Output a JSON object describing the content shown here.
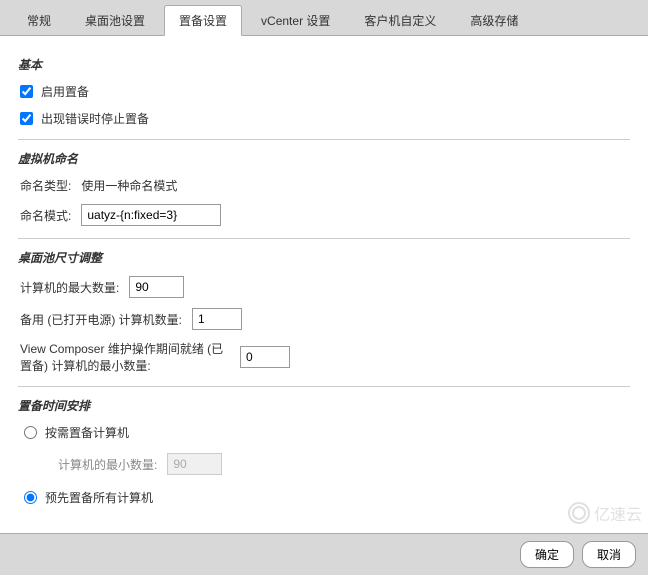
{
  "tabs": {
    "general": "常规",
    "pool_settings": "桌面池设置",
    "provisioning_settings": "置备设置",
    "vcenter_settings": "vCenter 设置",
    "guest_customization": "客户机自定义",
    "advanced_storage": "高级存储"
  },
  "sections": {
    "basic": {
      "title": "基本",
      "enable_provisioning": "启用置备",
      "stop_on_error": "出现错误时停止置备"
    },
    "vm_naming": {
      "title": "虚拟机命名",
      "naming_type_label": "命名类型:",
      "naming_type_value": "使用一种命名模式",
      "naming_pattern_label": "命名模式:",
      "naming_pattern_value": "uatyz-{n:fixed=3}"
    },
    "pool_sizing": {
      "title": "桌面池尺寸调整",
      "max_machines_label": "计算机的最大数量:",
      "max_machines_value": "90",
      "spare_machines_label": "备用 (已打开电源) 计算机数量:",
      "spare_machines_value": "1",
      "min_ready_label": "View Composer 维护操作期间就绪 (已置备) 计算机的最小数量:",
      "min_ready_value": "0"
    },
    "timing": {
      "title": "置备时间安排",
      "on_demand_label": "按需置备计算机",
      "min_machines_label": "计算机的最小数量:",
      "min_machines_value": "90",
      "upfront_label": "预先置备所有计算机"
    }
  },
  "footer": {
    "ok": "确定",
    "cancel": "取消"
  },
  "watermark": "亿速云"
}
